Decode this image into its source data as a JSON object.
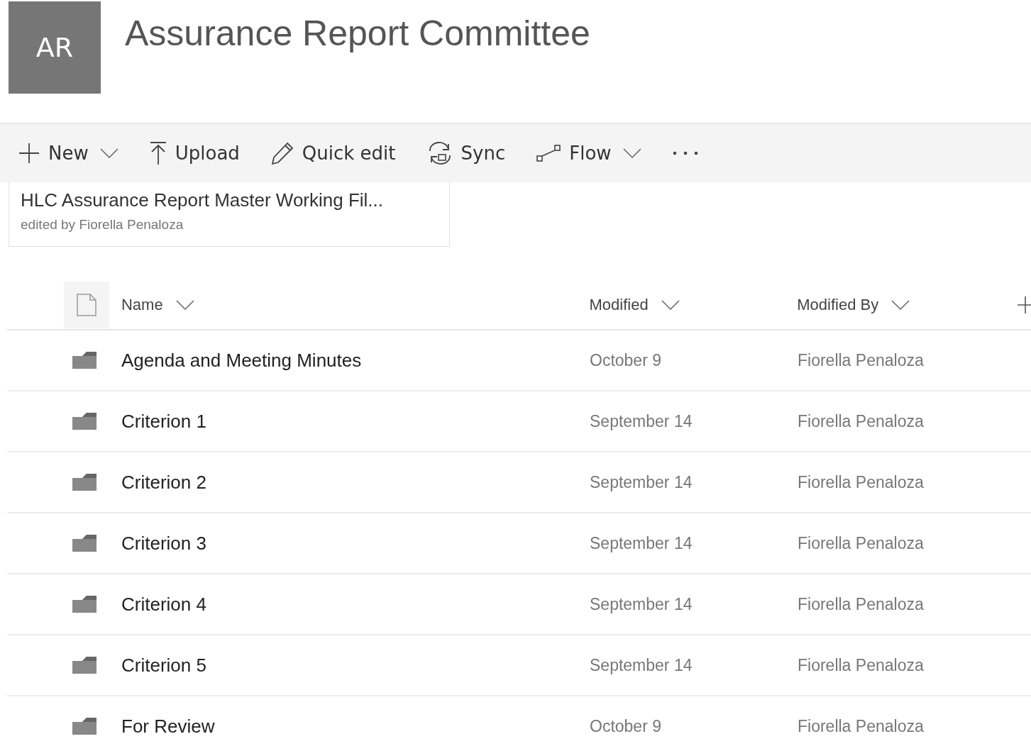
{
  "site": {
    "logo": "AR",
    "title": "Assurance Report Committee"
  },
  "toolbar": [
    {
      "kind": "plus",
      "label": "New",
      "has_menu": true
    },
    {
      "kind": "upload",
      "label": "Upload",
      "has_menu": false
    },
    {
      "kind": "pencil",
      "label": "Quick edit",
      "has_menu": false
    },
    {
      "kind": "sync",
      "label": "Sync",
      "has_menu": false
    },
    {
      "kind": "flow",
      "label": "Flow",
      "has_menu": true
    },
    {
      "kind": "more",
      "has_menu": false
    }
  ],
  "recent_file": {
    "name": "HLC Assurance Report Master Working Fil...",
    "edited": "edited by Fiorella Penaloza"
  },
  "table": {
    "columns": [
      "Name",
      "Modified",
      "Modified By"
    ],
    "rows": [
      {
        "name": "Agenda and Meeting Minutes",
        "modified": "October 9",
        "modified_by": "Fiorella Penaloza"
      },
      {
        "name": "Criterion 1",
        "modified": "September 14",
        "modified_by": "Fiorella Penaloza"
      },
      {
        "name": "Criterion 2",
        "modified": "September 14",
        "modified_by": "Fiorella Penaloza"
      },
      {
        "name": "Criterion 3",
        "modified": "September 14",
        "modified_by": "Fiorella Penaloza"
      },
      {
        "name": "Criterion 4",
        "modified": "September 14",
        "modified_by": "Fiorella Penaloza"
      },
      {
        "name": "Criterion 5",
        "modified": "September 14",
        "modified_by": "Fiorella Penaloza"
      },
      {
        "name": "For Review",
        "modified": "October 9",
        "modified_by": "Fiorella Penaloza"
      }
    ]
  }
}
